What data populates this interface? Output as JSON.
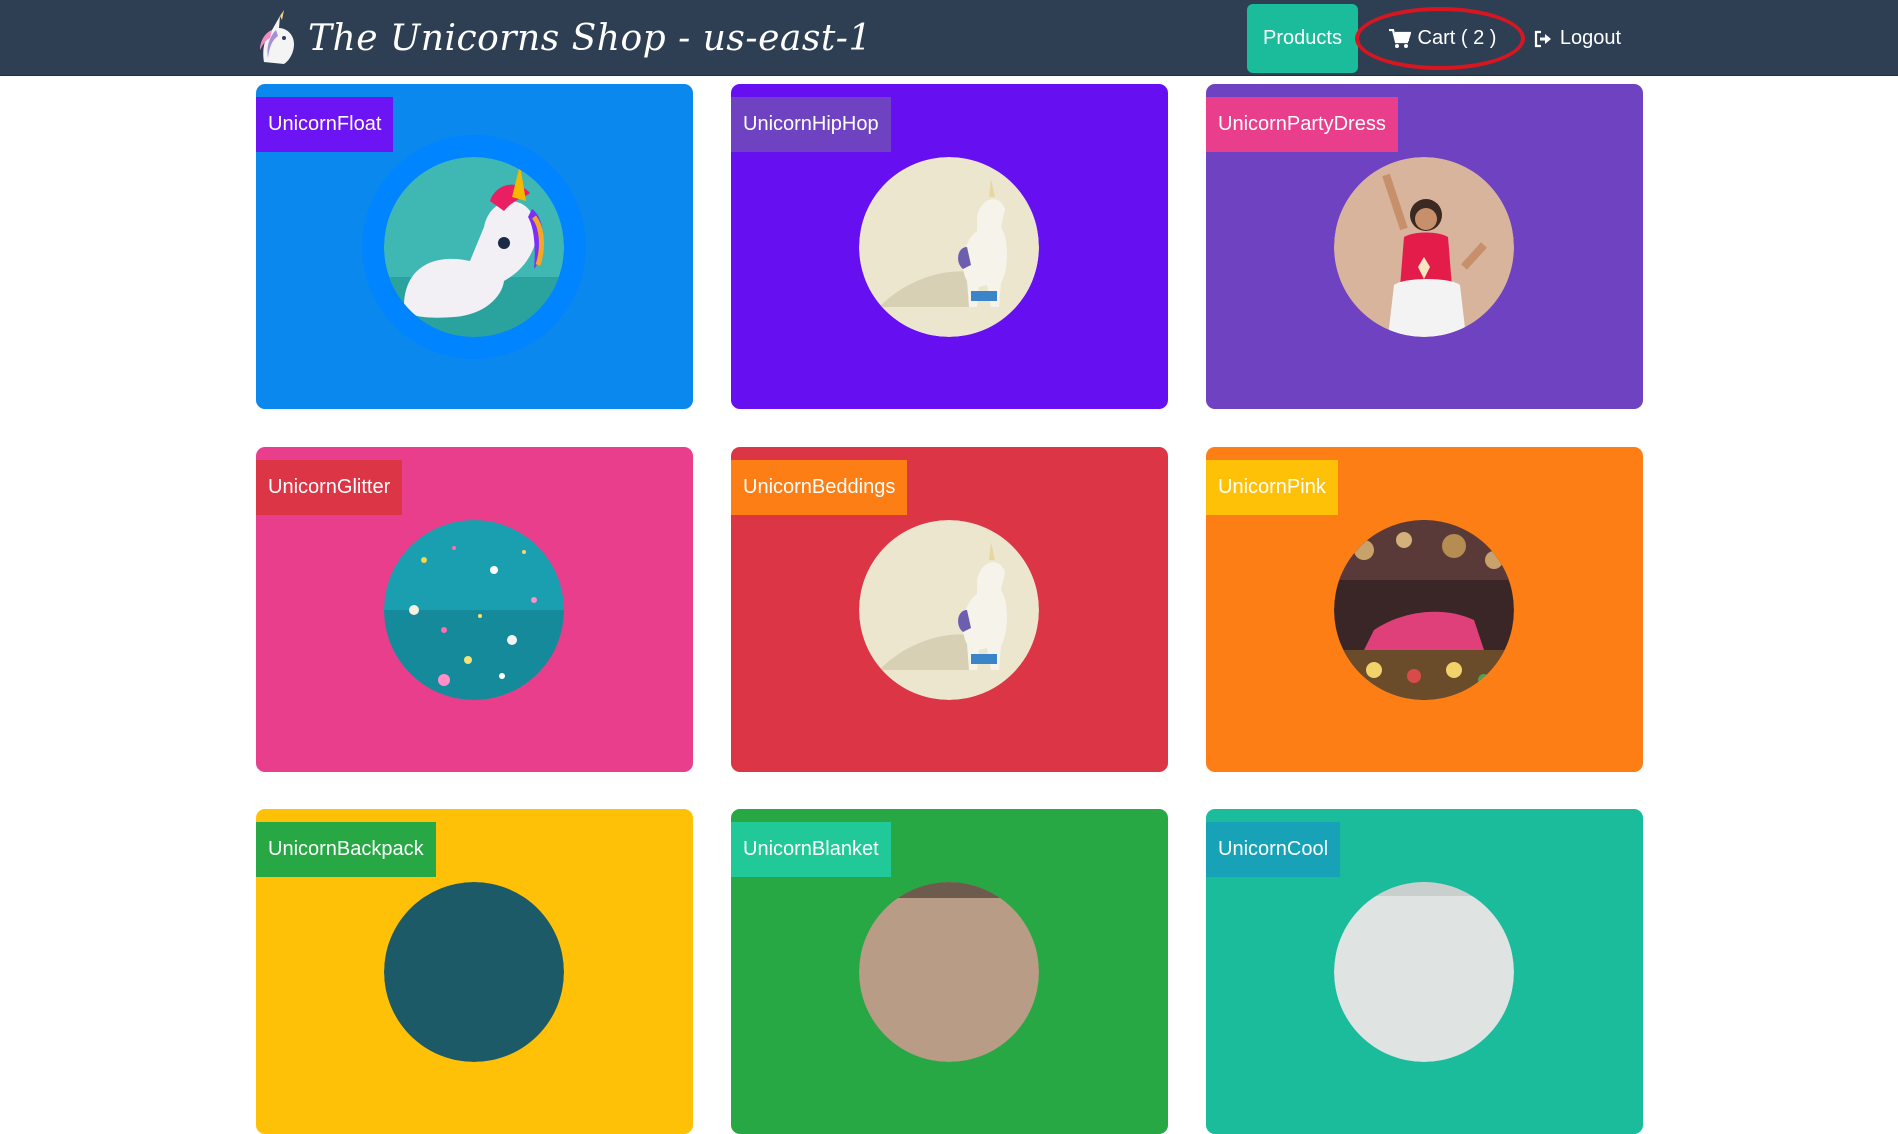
{
  "header": {
    "brand_title": "The Unicorns Shop - us-east-1",
    "logo_icon": "unicorn-logo-icon",
    "nav": {
      "products_label": "Products",
      "cart_label": "Cart ( 2 )",
      "cart_icon": "shopping-cart-icon",
      "logout_label": "Logout",
      "logout_icon": "sign-out-icon"
    },
    "colors": {
      "navbar": "#2e3f54",
      "active": "#1abc9c",
      "highlight_ring": "#d9161f"
    }
  },
  "products": [
    {
      "name": "UnicornFloat",
      "card_color": "#0a88ed",
      "label_color": "#6d14f5",
      "image": "inflatable-unicorn-pool-image"
    },
    {
      "name": "UnicornHipHop",
      "card_color": "#6610f2",
      "label_color": "#6f42c1",
      "image": "unicorn-toy-image"
    },
    {
      "name": "UnicornPartyDress",
      "card_color": "#6f42c1",
      "label_color": "#e83e8c",
      "image": "girl-party-dress-image"
    },
    {
      "name": "UnicornGlitter",
      "card_color": "#e83e8c",
      "label_color": "#dc3545",
      "image": "glitter-confetti-image"
    },
    {
      "name": "UnicornBeddings",
      "card_color": "#dc3545",
      "label_color": "#fd7e14",
      "image": "unicorn-toy-image"
    },
    {
      "name": "UnicornPink",
      "card_color": "#fd7e14",
      "label_color": "#ffc107",
      "image": "pink-unicorn-market-image"
    },
    {
      "name": "UnicornBackpack",
      "card_color": "#ffc107",
      "label_color": "#28a745",
      "image": "backpack-image"
    },
    {
      "name": "UnicornBlanket",
      "card_color": "#28a745",
      "label_color": "#20c997",
      "image": "blanket-image"
    },
    {
      "name": "UnicornCool",
      "card_color": "#1abc9c",
      "label_color": "#17a2b8",
      "image": "cool-unicorn-image"
    }
  ]
}
